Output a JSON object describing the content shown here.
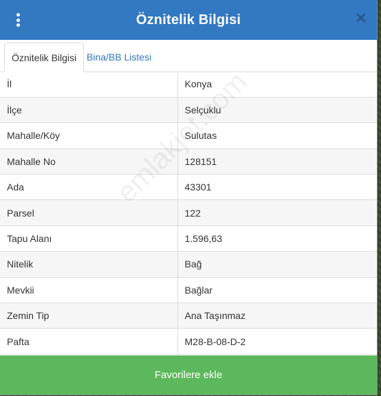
{
  "header": {
    "title": "Öznitelik Bilgisi"
  },
  "tabs": [
    {
      "label": "Öznitelik Bilgisi"
    },
    {
      "label": "Bina/BB Listesi"
    }
  ],
  "rows": [
    {
      "key": "İl",
      "value": "Konya"
    },
    {
      "key": "İlçe",
      "value": "Selçuklu"
    },
    {
      "key": "Mahalle/Köy",
      "value": "Sulutas"
    },
    {
      "key": "Mahalle No",
      "value": "128151"
    },
    {
      "key": "Ada",
      "value": "43301"
    },
    {
      "key": "Parsel",
      "value": "122"
    },
    {
      "key": "Tapu Alanı",
      "value": "1.596,63"
    },
    {
      "key": "Nitelik",
      "value": "Bağ"
    },
    {
      "key": "Mevkii",
      "value": "Bağlar"
    },
    {
      "key": "Zemin Tip",
      "value": "Ana Taşınmaz"
    },
    {
      "key": "Pafta",
      "value": "M28-B-08-D-2"
    }
  ],
  "watermark": "emlakjet.com",
  "footer": {
    "button_label": "Favorilere ekle"
  },
  "colors": {
    "header": "#3279c2",
    "footer": "#5cb85c",
    "tab_link": "#2f77c0"
  }
}
